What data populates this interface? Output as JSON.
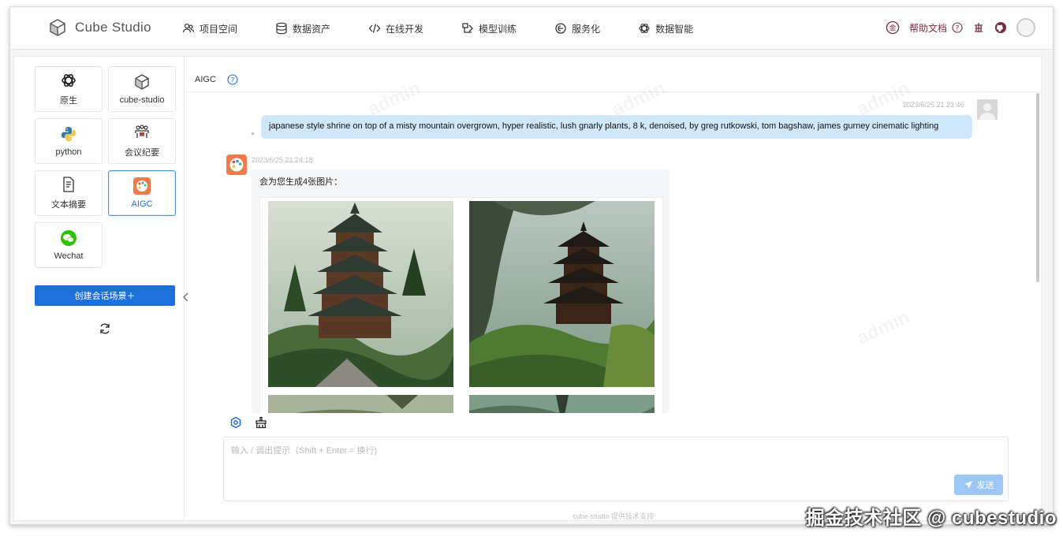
{
  "header": {
    "app_name": "Cube Studio",
    "nav": [
      {
        "label": "项目空间",
        "icon": "users-icon"
      },
      {
        "label": "数据资产",
        "icon": "database-icon"
      },
      {
        "label": "在线开发",
        "icon": "code-icon"
      },
      {
        "label": "模型训练",
        "icon": "model-icon"
      },
      {
        "label": "服务化",
        "icon": "service-icon"
      },
      {
        "label": "数据智能",
        "icon": "openai-icon"
      }
    ],
    "help_label": "帮助文档"
  },
  "sidebar": {
    "cards": [
      {
        "label": "原生",
        "icon": "openai-icon"
      },
      {
        "label": "cube-studio",
        "icon": "cube-icon"
      },
      {
        "label": "python",
        "icon": "python-icon"
      },
      {
        "label": "会议纪要",
        "icon": "meeting-icon"
      },
      {
        "label": "文本摘要",
        "icon": "document-icon"
      },
      {
        "label": "AIGC",
        "icon": "palette-icon",
        "active": true
      },
      {
        "label": "Wechat",
        "icon": "wechat-icon"
      }
    ],
    "create_button": "创建会话场景＋"
  },
  "chat": {
    "title": "AIGC",
    "user_message": {
      "time": "2023/6/25 21:23:46",
      "text": "japanese style shrine on top of a misty mountain overgrown, hyper realistic, lush gnarly plants, 8 k, denoised, by greg rutkowski, tom bagshaw, james gurney cinematic lighting"
    },
    "bot_message": {
      "time": "2023/6/25 21:24:18",
      "text": "会为您生成4张图片："
    },
    "input_placeholder": "输入 / 调出提示（Shift + Enter = 换行)",
    "send_label": "发送",
    "footer": "cube-studio 提供技术支持"
  },
  "watermark": "admin",
  "credit": "掘金技术社区 @ cubestudio",
  "colors": {
    "primary": "#1d6fdc",
    "user_bubble": "#cfe8fb",
    "help": "#7b2a3a"
  }
}
